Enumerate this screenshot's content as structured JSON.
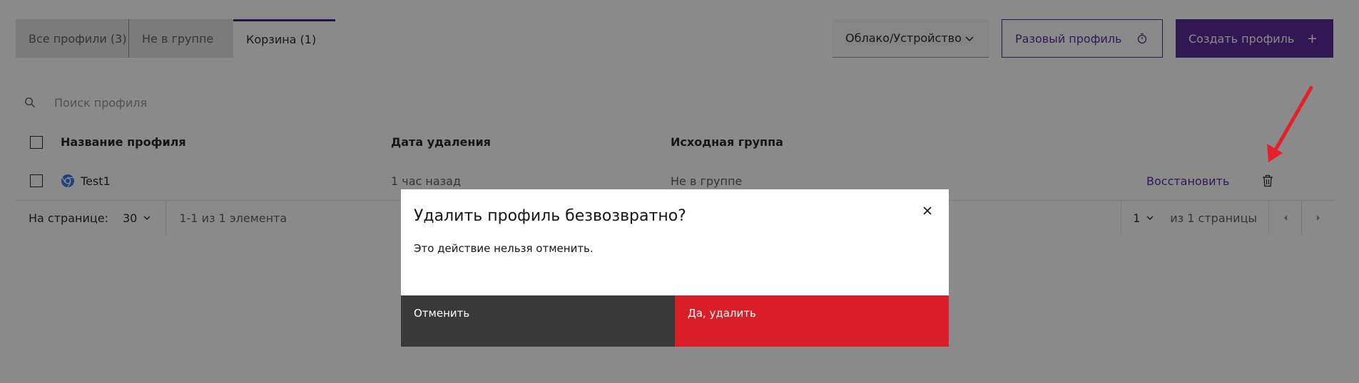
{
  "tabs": [
    {
      "label": "Все профили (3)"
    },
    {
      "label": "Не в группе"
    },
    {
      "label": "Корзина (1)"
    }
  ],
  "toolbar": {
    "dropdown_label": "Облако/Устройство",
    "one_time_label": "Разовый профиль",
    "create_label": "Создать профиль",
    "create_icon": "+"
  },
  "search": {
    "placeholder": "Поиск профиля"
  },
  "table": {
    "headers": {
      "name": "Название профиля",
      "date": "Дата удаления",
      "group": "Исходная группа"
    },
    "rows": [
      {
        "name": "Test1",
        "date": "1 час назад",
        "group": "Не в группе",
        "restore_label": "Восстановить",
        "browser_icon": "chrome-icon"
      }
    ]
  },
  "pagination": {
    "per_page_label": "На странице:",
    "per_page_value": "30",
    "count_text": "1-1 из 1 элемента",
    "page_value": "1",
    "total_pages_text": "из 1 страницы"
  },
  "modal": {
    "title": "Удалить профиль безвозвратно?",
    "text": "Это действие нельзя отменить.",
    "cancel_label": "Отменить",
    "confirm_label": "Да, удалить"
  },
  "colors": {
    "brand": "#4a1a92",
    "danger": "#da1e28",
    "cancel": "#393939",
    "annotation": "#e5202a"
  }
}
